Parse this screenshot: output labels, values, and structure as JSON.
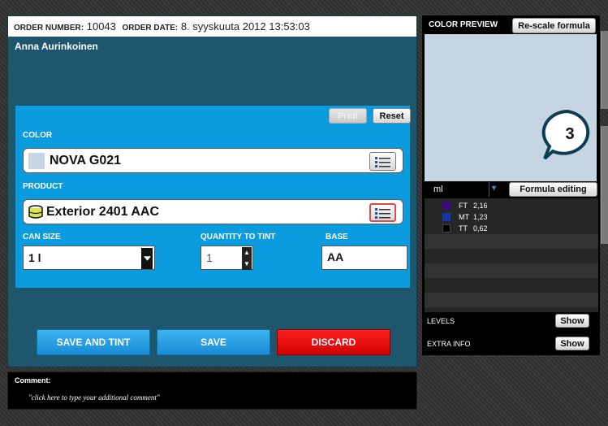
{
  "order": {
    "number_label": "ORDER NUMBER:",
    "number_value": "10043",
    "date_label": "ORDER DATE:",
    "date_value": "8. syyskuuta 2012 13:53:03",
    "customer_name": "Anna Aurinkoinen"
  },
  "toolbar": {
    "print_label": "Print",
    "reset_label": "Reset"
  },
  "color": {
    "label": "COLOR",
    "value": "NOVA G021",
    "swatch_color": "#c6d5e2"
  },
  "product": {
    "label": "PRODUCT",
    "value": "Exterior 2401 AAC"
  },
  "can_size": {
    "label": "CAN SIZE",
    "value": "1 l"
  },
  "quantity": {
    "label": "QUANTITY TO TINT",
    "value": "1"
  },
  "base": {
    "label": "BASE",
    "value": "AA"
  },
  "actions": {
    "save_and_tint": "SAVE AND TINT",
    "save": "SAVE",
    "discard": "DISCARD"
  },
  "comment": {
    "label": "Comment:",
    "placeholder": "\"click here to type your additional comment\""
  },
  "preview": {
    "label": "COLOR PREVIEW",
    "rescale_label": "Re-scale formula",
    "preview_color": "#c6d5e2"
  },
  "formula": {
    "unit": "ml",
    "edit_label": "Formula editing",
    "items": [
      {
        "code": "FT",
        "amount": "2,16",
        "color": "#3a0a7a"
      },
      {
        "code": "MT",
        "amount": "1,23",
        "color": "#1238a8"
      },
      {
        "code": "TT",
        "amount": "0,62",
        "color": "#000000"
      }
    ]
  },
  "levels": {
    "label": "LEVELS",
    "button": "Show"
  },
  "extra_info": {
    "label": "EXTRA INFO",
    "button": "Show"
  },
  "callout": {
    "number": "3"
  },
  "colors": {
    "panel": "#1d566d",
    "form": "#0b9ce0",
    "accent_blue": "#1a8bd6",
    "discard_red": "#e00000"
  },
  "icons": {
    "list": "list-icon",
    "product": "paint-can-icon",
    "dropdown": "chevron-down-icon"
  }
}
